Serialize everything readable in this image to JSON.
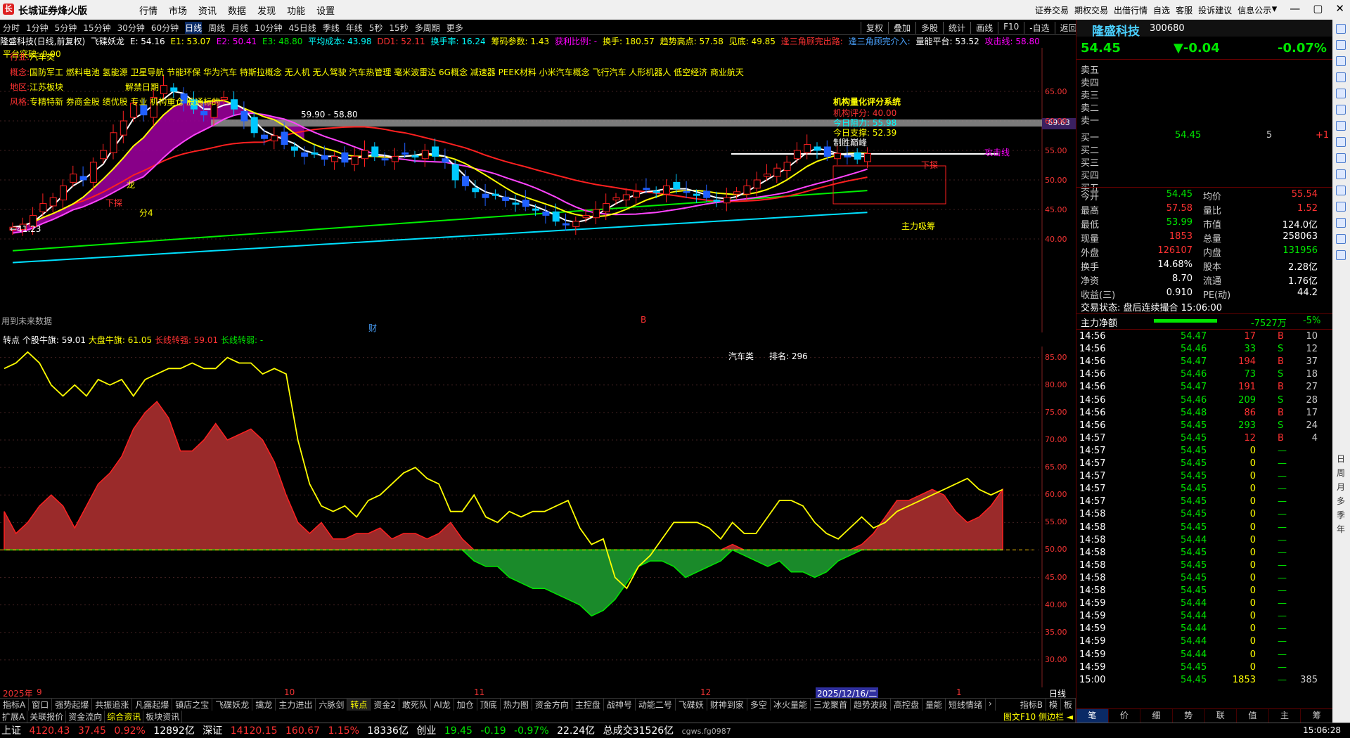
{
  "titlebar": {
    "app_title": "长城证券烽火版",
    "logo_char": "长",
    "menu": [
      "行情",
      "市场",
      "资讯",
      "数据",
      "发现",
      "功能",
      "设置"
    ],
    "right_menu": [
      "证券交易",
      "期权交易",
      "出借行情",
      "自选",
      "客服",
      "投诉建议",
      "信息公示"
    ],
    "win": [
      "▾",
      "—",
      "▢",
      "✕"
    ]
  },
  "toolbar": {
    "periods": [
      "分时",
      "1分钟",
      "5分钟",
      "15分钟",
      "30分钟",
      "60分钟",
      "日线",
      "周线",
      "月线",
      "10分钟",
      "45日线",
      "季线",
      "年线",
      "5秒",
      "15秒",
      "多周期",
      "更多"
    ],
    "active_period": "日线",
    "tools": [
      "复权",
      "叠加",
      "多股",
      "统计",
      "画线",
      "F10",
      "-自选",
      "返回"
    ]
  },
  "info": {
    "stock": "隆盛科技(日线,前复权)",
    "indicator": "飞碟妖龙",
    "E": "E: 54.16",
    "E1": "E1: 53.07",
    "E2": "E2: 50.41",
    "E3": "E3: 48.80",
    "avg_cost": "平均成本: 43.98",
    "DD1": "DD1: 52.11",
    "turnover": "换手率: 16.24",
    "chip": "筹码参数: 1.43",
    "profit_ratio": "获利比例: -",
    "turn": "换手: 180.57",
    "trend_high": "趋势高点: 57.58",
    "peak": "见底: 49.85",
    "tri_out": "逢三角顾完出路:",
    "tri_in": "逢三角顾完介入:",
    "platform": "量能平台: 53.52",
    "attack": "攻击线: 58.80"
  },
  "overlay": {
    "platform_break": "平台突破: 0.00",
    "industry_label": "行业:",
    "industry": "汽车类",
    "concept_label": "概念:",
    "concepts": "国防军工 燃料电池 氢能源 卫星导航 节能环保 华为汽车 特斯拉概念 无人机 无人驾驶 汽车热管理 毫米波雷达 6G概念 减速器 PEEK材料 小米汽车概念 飞行汽车 人形机器人 低空经济 商业航天",
    "region_label": "地区:",
    "region": "江苏板块",
    "style_label": "风格:",
    "style": "专精特新 券商金股 绩优股 专业 机构重仓 股通标的",
    "unlock": "解禁日期",
    "rating_title": "机构量化评分系统",
    "rating": "机构评分: 40.00",
    "pressure": "今日阻力: 55.98",
    "support": "今日支撑: 52.39",
    "strategy": "制胜巅峰",
    "range_label": "59.90 - 58.80",
    "low_label": "←41.23",
    "future": "用到未来数据",
    "attack_line": "攻击线",
    "main_absorb": "主力吸筹",
    "cai": "财",
    "price_tag": "69.63",
    "labels_xiatan": "下探",
    "labels_long": "龙",
    "labels_fen": "分4",
    "labels_B": "B"
  },
  "price_axis": [
    "65.00",
    "60.00",
    "55.00",
    "50.00",
    "45.00",
    "40.00"
  ],
  "indicator": {
    "name": "转点",
    "stock": "个股牛旗: 59.01",
    "market": "大盘牛旗: 61.05",
    "long_strong": "长线转强: 59.01",
    "long_weak": "长线转弱: -",
    "sector": "汽车类",
    "rank": "排名: 296"
  },
  "sub_axis": [
    "85.00",
    "80.00",
    "75.00",
    "70.00",
    "65.00",
    "60.00",
    "55.00",
    "50.00",
    "45.00",
    "40.00",
    "35.00",
    "30.00"
  ],
  "chart_data": {
    "type": "line",
    "series": [
      {
        "name": "大盘牛旗",
        "values": [
          83,
          84,
          86,
          84,
          80,
          78,
          80,
          78,
          81,
          80,
          81,
          78,
          81,
          82,
          83,
          83,
          84,
          83,
          83,
          85,
          84,
          84,
          82,
          83,
          82,
          70,
          62,
          58,
          57,
          58,
          56,
          59,
          60,
          62,
          64,
          65,
          63,
          62,
          57,
          57,
          60,
          56,
          55,
          57,
          56,
          57,
          57,
          58,
          59,
          54,
          51,
          52,
          45,
          43,
          47,
          49,
          52,
          55,
          55,
          55,
          54,
          52,
          55,
          53,
          53,
          56,
          59,
          59,
          58,
          55,
          53,
          52,
          54,
          56,
          54,
          55,
          57,
          58,
          59,
          60,
          61,
          62,
          63,
          61,
          60,
          61
        ]
      },
      {
        "name": "个股牛旗",
        "values": [
          57,
          53,
          55,
          58,
          60,
          58,
          54,
          58,
          62,
          64,
          67,
          72,
          75,
          77,
          74,
          68,
          68,
          70,
          73,
          70,
          71,
          72,
          70,
          66,
          60,
          55,
          53,
          55,
          52,
          52,
          53,
          53,
          54,
          52,
          53,
          53,
          52,
          53,
          55,
          52,
          48,
          47,
          47,
          45,
          44,
          43,
          43,
          42,
          41,
          40,
          38,
          39,
          41,
          44,
          47,
          48,
          48,
          47,
          45,
          46,
          47,
          48,
          51,
          49,
          48,
          47,
          48,
          46,
          46,
          45,
          46,
          48,
          49,
          51,
          53,
          56,
          59,
          59,
          60,
          61,
          60,
          57,
          55,
          56,
          58,
          61
        ]
      }
    ],
    "ylim": [
      25,
      87
    ],
    "ref_line": 50
  },
  "xaxis": [
    "2025年",
    "9",
    "10",
    "11",
    "12",
    "2025/12/16/二",
    "1"
  ],
  "tabs1": [
    "指标A",
    "窗口",
    "强势起爆",
    "共振追涨",
    "凡露起爆",
    "镇店之宝",
    "飞碟妖龙",
    "擒龙",
    "主力进出",
    "六脉剑",
    "转点",
    "资金2",
    "敢死队",
    "AI龙",
    "加仓",
    "顶底",
    "热力图",
    "资金方向",
    "主控盘",
    "战神号",
    "动能二号",
    "飞碟妖",
    "财神到家",
    "多空",
    "冰火量能",
    "三龙聚首",
    "趋势波段",
    "高控盘",
    "量能",
    "短线情绪",
    "›"
  ],
  "tabs1_active": "转点",
  "tabs1_right": [
    "指标B",
    "模",
    "板"
  ],
  "period_label": "日线",
  "tabs2": [
    "扩展A",
    "关联报价",
    "资金流向",
    "综合资讯",
    "板块资讯"
  ],
  "tabs2_active": "综合资讯",
  "tabs2_right": "图文F10 侧边栏 ◄",
  "bottom_tabs": [
    "笔",
    "价",
    "细",
    "势",
    "联",
    "值",
    "主",
    "筹"
  ],
  "statusbar": {
    "sh_label": "上证",
    "sh": "4120.43",
    "sh_chg": "37.45",
    "sh_pct": "0.92%",
    "sh_amt": "12892亿",
    "sz_label": "深证",
    "sz": "14120.15",
    "sz_chg": "160.67",
    "sz_pct": "1.15%",
    "sz_amt": "18336亿",
    "cy_label": "创业",
    "cy": "19.45",
    "cy_chg": "-0.19",
    "cy_pct": "-0.97%",
    "cy_amt": "22.24亿",
    "total": "总成交31526亿",
    "server": "cgws.fg0987",
    "time": "15:06:28"
  },
  "quote": {
    "name": "隆盛科技",
    "code": "300680",
    "price": "54.45",
    "chg": "▼-0.04",
    "pct": "-0.07%",
    "sell": [
      "卖五",
      "卖四",
      "卖三",
      "卖二",
      "卖一"
    ],
    "buy": [
      {
        "k": "买一",
        "p": "54.45",
        "v": "5",
        "d": "+1"
      },
      {
        "k": "买二",
        "p": "",
        "v": "",
        "d": ""
      },
      {
        "k": "买三",
        "p": "",
        "v": "",
        "d": ""
      },
      {
        "k": "买四",
        "p": "",
        "v": "",
        "d": ""
      },
      {
        "k": "买五",
        "p": "",
        "v": "",
        "d": ""
      }
    ],
    "stats": [
      {
        "k1": "今开",
        "v1": "54.45",
        "c1": "green",
        "k2": "均价",
        "v2": "55.54",
        "c2": "red"
      },
      {
        "k1": "最高",
        "v1": "57.58",
        "c1": "red",
        "k2": "量比",
        "v2": "1.52",
        "c2": "red"
      },
      {
        "k1": "最低",
        "v1": "53.99",
        "c1": "green",
        "k2": "市值",
        "v2": "124.0亿",
        "c2": "white"
      },
      {
        "k1": "现量",
        "v1": "1853",
        "c1": "red",
        "k2": "总量",
        "v2": "258063",
        "c2": "white"
      },
      {
        "k1": "外盘",
        "v1": "126107",
        "c1": "red",
        "k2": "内盘",
        "v2": "131956",
        "c2": "green"
      },
      {
        "k1": "换手",
        "v1": "14.68%",
        "c1": "white",
        "k2": "股本",
        "v2": "2.28亿",
        "c2": "white"
      },
      {
        "k1": "净资",
        "v1": "8.70",
        "c1": "white",
        "k2": "流通",
        "v2": "1.76亿",
        "c2": "white"
      },
      {
        "k1": "收益(三)",
        "v1": "0.910",
        "c1": "white",
        "k2": "PE(动)",
        "v2": "44.2",
        "c2": "white"
      }
    ],
    "trade_state": "交易状态: 盘后连续撮合 15:06:00",
    "main_net_label": "主力净额",
    "main_net": "-7527万",
    "main_net_pct": "-5%",
    "ticks": [
      [
        "14:56",
        "54.47",
        "17",
        "B",
        "10"
      ],
      [
        "14:56",
        "54.46",
        "33",
        "S",
        "12"
      ],
      [
        "14:56",
        "54.47",
        "194",
        "B",
        "37"
      ],
      [
        "14:56",
        "54.46",
        "73",
        "S",
        "18"
      ],
      [
        "14:56",
        "54.47",
        "191",
        "B",
        "27"
      ],
      [
        "14:56",
        "54.46",
        "209",
        "S",
        "28"
      ],
      [
        "14:56",
        "54.48",
        "86",
        "B",
        "17"
      ],
      [
        "14:56",
        "54.45",
        "293",
        "S",
        "24"
      ],
      [
        "14:57",
        "54.45",
        "12",
        "B",
        "4"
      ],
      [
        "14:57",
        "54.45",
        "0",
        "",
        ""
      ],
      [
        "14:57",
        "54.45",
        "0",
        "",
        ""
      ],
      [
        "14:57",
        "54.45",
        "0",
        "",
        ""
      ],
      [
        "14:57",
        "54.45",
        "0",
        "",
        ""
      ],
      [
        "14:57",
        "54.45",
        "0",
        "",
        ""
      ],
      [
        "14:58",
        "54.45",
        "0",
        "",
        ""
      ],
      [
        "14:58",
        "54.45",
        "0",
        "",
        ""
      ],
      [
        "14:58",
        "54.44",
        "0",
        "",
        ""
      ],
      [
        "14:58",
        "54.45",
        "0",
        "",
        ""
      ],
      [
        "14:58",
        "54.45",
        "0",
        "",
        ""
      ],
      [
        "14:58",
        "54.45",
        "0",
        "",
        ""
      ],
      [
        "14:58",
        "54.45",
        "0",
        "",
        ""
      ],
      [
        "14:59",
        "54.44",
        "0",
        "",
        ""
      ],
      [
        "14:59",
        "54.44",
        "0",
        "",
        ""
      ],
      [
        "14:59",
        "54.44",
        "0",
        "",
        ""
      ],
      [
        "14:59",
        "54.44",
        "0",
        "",
        ""
      ],
      [
        "14:59",
        "54.44",
        "0",
        "",
        ""
      ],
      [
        "14:59",
        "54.45",
        "0",
        "",
        ""
      ],
      [
        "15:00",
        "54.45",
        "1853",
        "",
        ""
      ]
    ],
    "tick_last_count": "385"
  },
  "colors": {
    "up": "#ff3232",
    "down": "#00e600",
    "bg": "#000000",
    "ma_yellow": "#ffff00",
    "ma_magenta": "#ff00ff",
    "ma_red": "#ff2020",
    "ma_green": "#00ee00",
    "ma_cyan": "#00e0ff"
  },
  "side_icons": [
    "chevron-up-icon",
    "grid-icon",
    "chart-icon",
    "list-icon",
    "news-icon",
    "calc-icon",
    "info-icon",
    "f10-icon",
    "money-icon",
    "doc-icon",
    "rsi-icon",
    "rank-icon",
    "move-icon",
    "bell-icon",
    "arrow-icon"
  ],
  "side_periods": [
    "日",
    "周",
    "月",
    "多",
    "季",
    "年"
  ]
}
